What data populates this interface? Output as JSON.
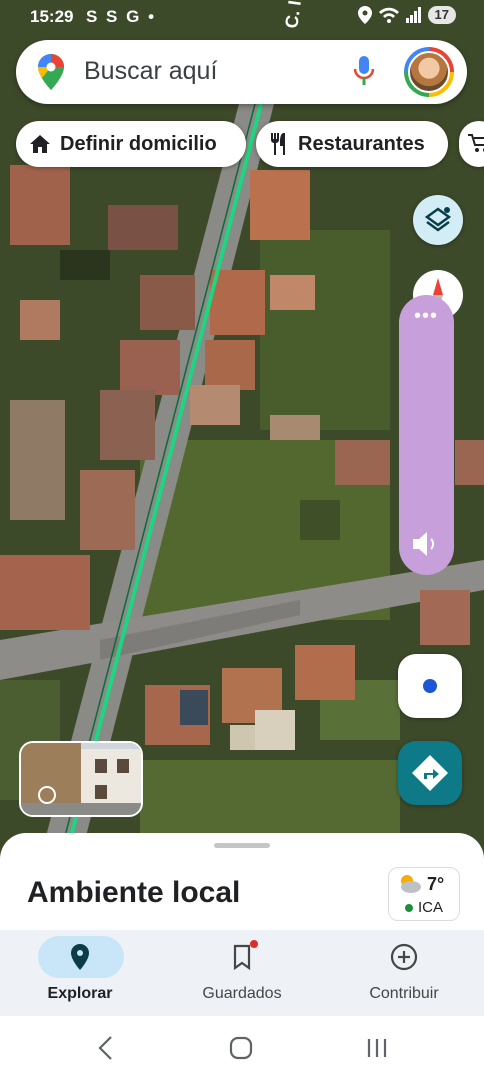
{
  "status_bar": {
    "time": "15:29",
    "notifications": "S S G •",
    "battery": "17"
  },
  "search": {
    "placeholder": "Buscar aquí"
  },
  "chips": {
    "home": "Definir domicilio",
    "restaurants": "Restaurantes"
  },
  "map": {
    "road_label": "C. In"
  },
  "sheet": {
    "title": "Ambiente local"
  },
  "weather": {
    "temperature": "7°",
    "air_quality": "ICA"
  },
  "nav": {
    "explore": "Explorar",
    "saved": "Guardados",
    "contribute": "Contribuir"
  },
  "colors": {
    "accent": "#0e7a87",
    "route_line": "#1ed682",
    "location": "#1a56d6",
    "volume_panel": "#c79fdb"
  },
  "icons": [
    "maps-pin-icon",
    "mic-icon",
    "home-icon",
    "restaurant-icon",
    "cart-icon",
    "layers-icon",
    "compass-icon",
    "volume-icon",
    "my-location-icon",
    "directions-icon",
    "explore-icon",
    "bookmark-icon",
    "add-circle-icon",
    "back-icon",
    "home-nav-icon",
    "recents-icon"
  ]
}
